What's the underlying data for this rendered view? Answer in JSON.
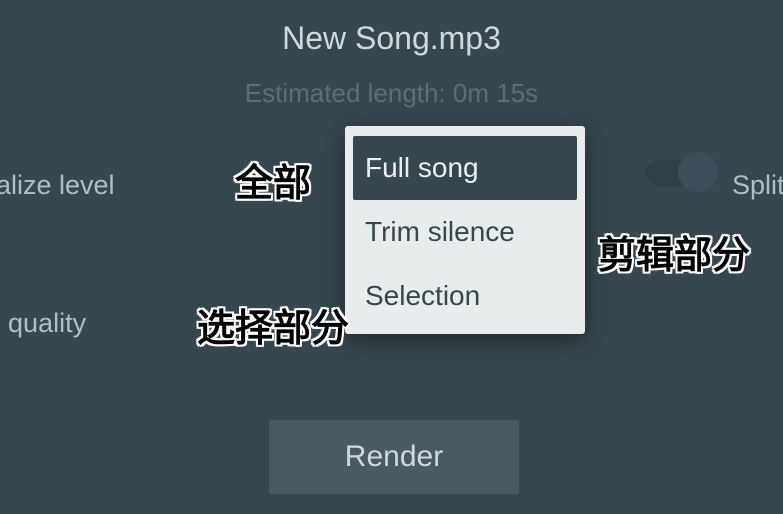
{
  "header": {
    "title": "New Song.mp3",
    "estimated": "Estimated length: 0m 15s"
  },
  "options": {
    "normalize_level": "Normalize level",
    "high_quality": "High quality",
    "split": "Split r"
  },
  "popup": {
    "full_song": "Full song",
    "trim_silence": "Trim silence",
    "selection": "Selection"
  },
  "render_button": "Render",
  "annotations": {
    "full": "全部",
    "trim": "剪辑部分",
    "selection": "选择部分"
  }
}
